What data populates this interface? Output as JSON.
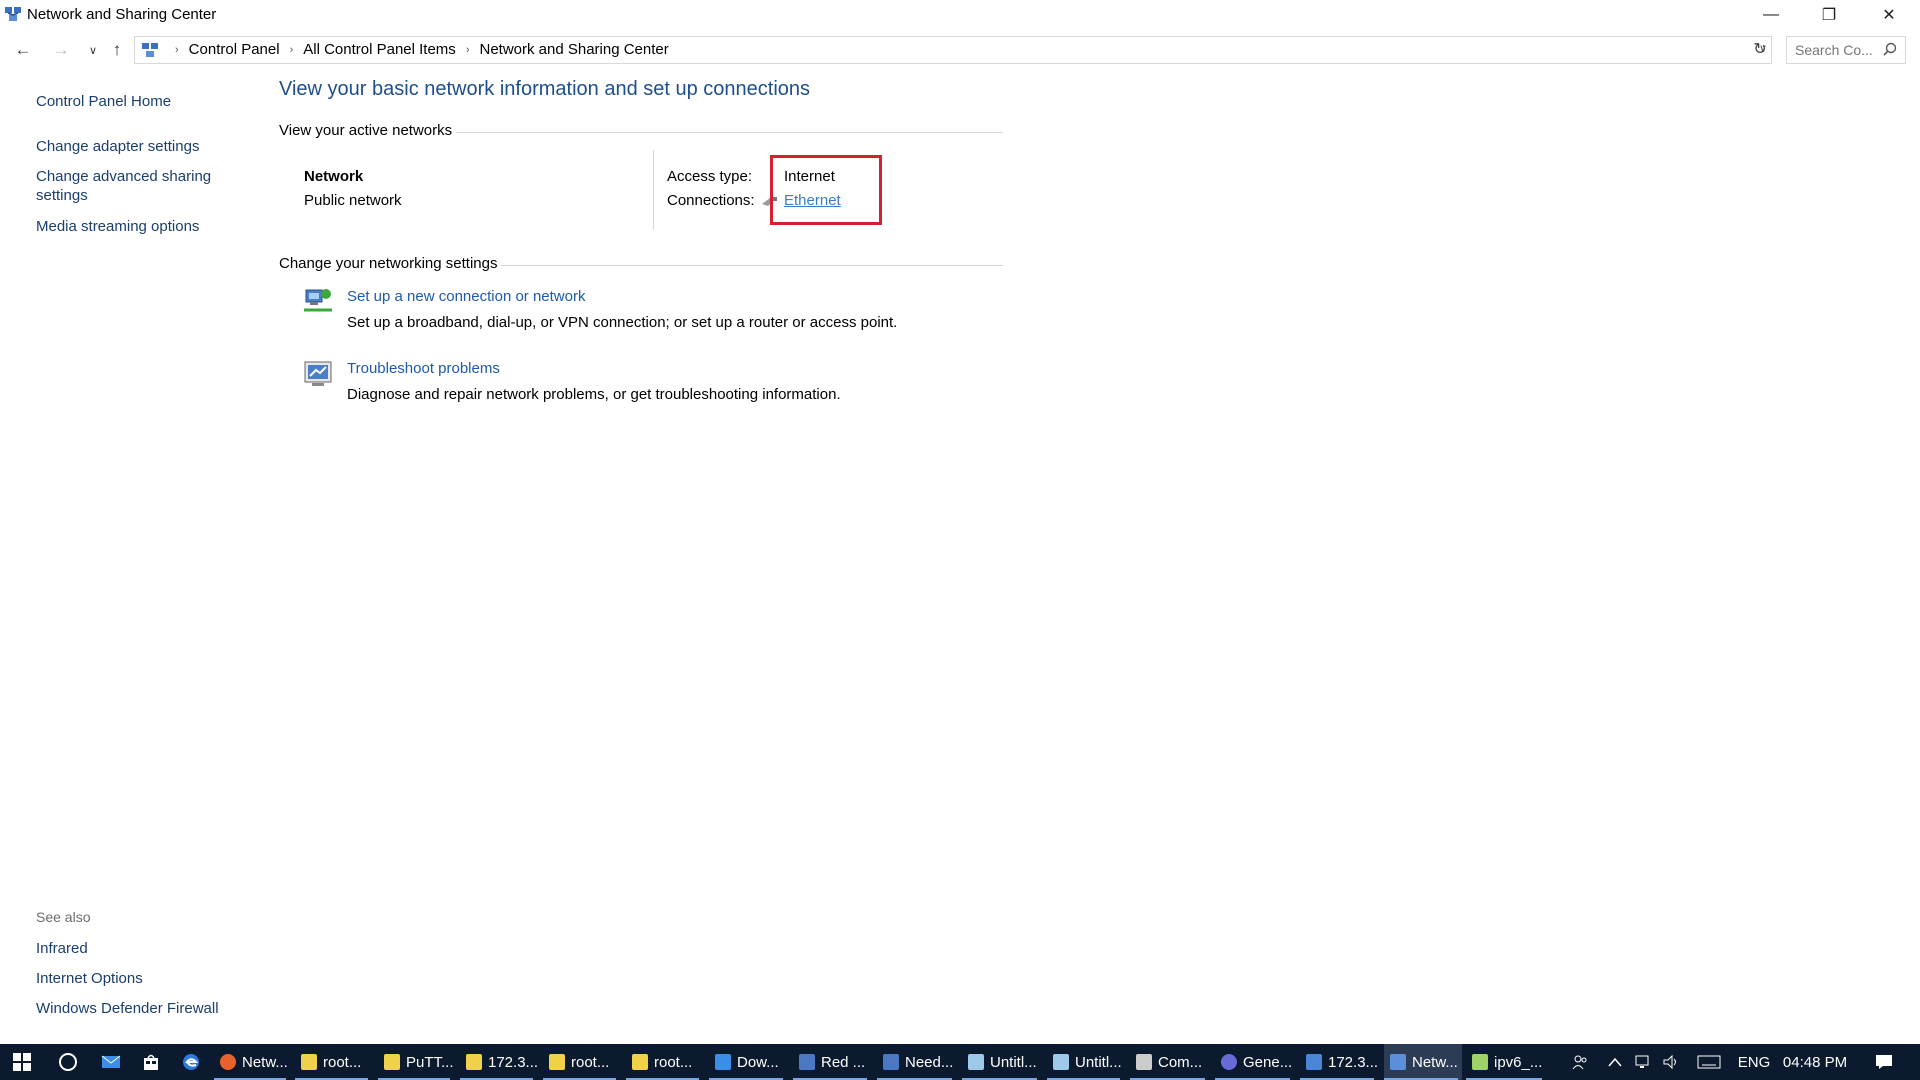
{
  "window": {
    "title": "Network and Sharing Center",
    "minimize": "—",
    "maximize": "❐",
    "close": "✕"
  },
  "nav": {
    "back": "←",
    "forward": "→",
    "recent": "∨",
    "up": "↑",
    "refresh": "↻",
    "dropdown": "∨"
  },
  "breadcrumb": {
    "items": [
      "Control Panel",
      "All Control Panel Items",
      "Network and Sharing Center"
    ],
    "separator": "›"
  },
  "search": {
    "placeholder": "Search Co..."
  },
  "left_pane": {
    "home": "Control Panel Home",
    "links": [
      "Change adapter settings",
      "Change advanced sharing settings",
      "Media streaming options"
    ],
    "see_also_label": "See also",
    "see_also": [
      "Infrared",
      "Internet Options",
      "Windows Defender Firewall"
    ]
  },
  "main": {
    "title": "View your basic network information and set up connections",
    "active_networks_header": "View your active networks",
    "network_name": "Network",
    "network_type": "Public network",
    "access_type_label": "Access type:",
    "access_type_value": "Internet",
    "connections_label": "Connections:",
    "connections_value": "Ethernet",
    "change_settings_header": "Change your networking settings",
    "tasks": [
      {
        "link": "Set up a new connection or network",
        "desc": "Set up a broadband, dial-up, or VPN connection; or set up a router or access point."
      },
      {
        "link": "Troubleshoot problems",
        "desc": "Diagnose and repair network problems, or get troubleshooting information."
      }
    ]
  },
  "colors": {
    "link": "#1e5ba8",
    "title": "#1e4e8c",
    "highlight": "#d6202e",
    "taskbar": "#0b1a2e"
  },
  "taskbar": {
    "apps": [
      {
        "label": "Netw...",
        "icon": "firefox-icon"
      },
      {
        "label": "root...",
        "icon": "putty-icon"
      },
      {
        "label": "PuTT...",
        "icon": "putty-icon"
      },
      {
        "label": "172.3...",
        "icon": "putty-icon"
      },
      {
        "label": "root...",
        "icon": "putty-icon"
      },
      {
        "label": "root...",
        "icon": "putty-icon"
      },
      {
        "label": "Dow...",
        "icon": "download-icon"
      },
      {
        "label": "Red ...",
        "icon": "word-icon"
      },
      {
        "label": "Need...",
        "icon": "word-icon"
      },
      {
        "label": "Untitl...",
        "icon": "notepad-icon"
      },
      {
        "label": "Untitl...",
        "icon": "notepad-icon"
      },
      {
        "label": "Com...",
        "icon": "cmd-icon"
      },
      {
        "label": "Gene...",
        "icon": "teams-icon"
      },
      {
        "label": "172.3...",
        "icon": "remote-desktop-icon"
      },
      {
        "label": "Netw...",
        "icon": "network-center-icon"
      },
      {
        "label": "ipv6_...",
        "icon": "paint-icon"
      }
    ],
    "language": "ENG",
    "time": "04:48 PM"
  }
}
